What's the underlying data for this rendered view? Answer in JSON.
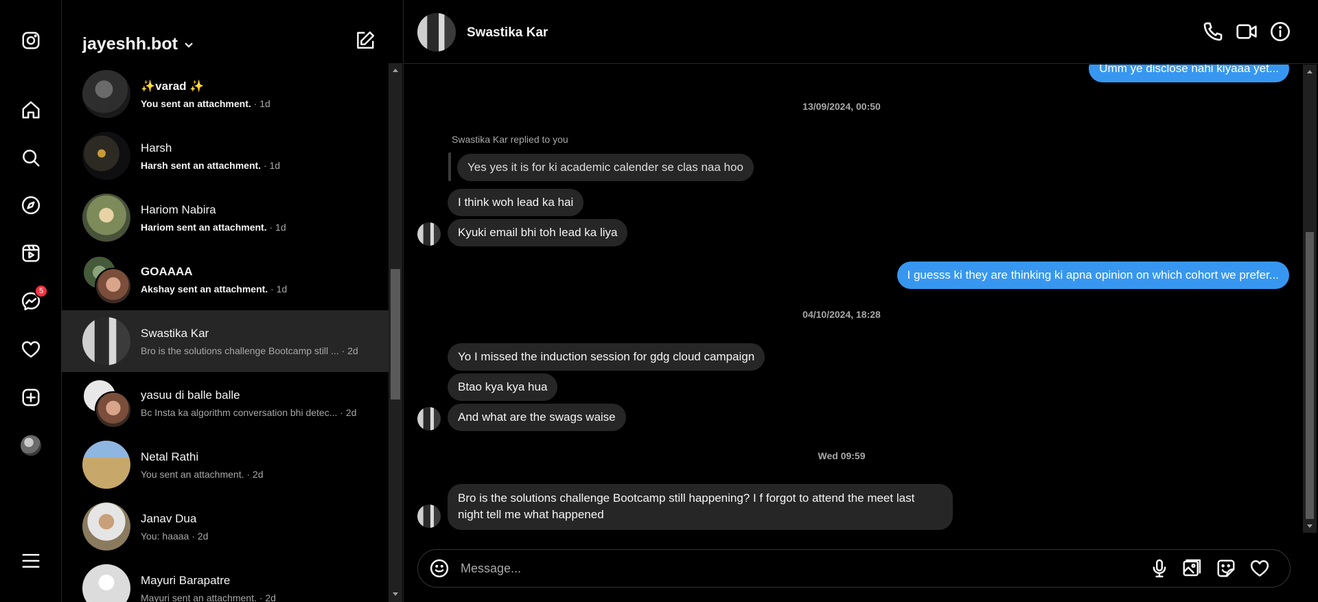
{
  "account": {
    "username": "jayeshh.bot"
  },
  "nav": {
    "messages_badge": "5"
  },
  "threads": [
    {
      "name": "✨varad ✨",
      "preview": "You sent an attachment.",
      "time": "· 1d",
      "unread": true
    },
    {
      "name": "Harsh",
      "preview": "Harsh sent an attachment.",
      "time": "· 1d",
      "unread": true
    },
    {
      "name": "Hariom Nabira",
      "preview": "Hariom sent an attachment.",
      "time": "· 1d",
      "unread": true
    },
    {
      "name": "GOAAAA",
      "preview": "Akshay sent an attachment.",
      "time": "· 1d",
      "unread": true
    },
    {
      "name": "Swastika Kar",
      "preview": "Bro is the solutions challenge Bootcamp still ...",
      "time": "· 2d",
      "unread": false
    },
    {
      "name": "yasuu di balle balle",
      "preview": "Bc Insta ka algorithm conversation bhi detec...",
      "time": "· 2d",
      "unread": false
    },
    {
      "name": "Netal Rathi",
      "preview": "You sent an attachment.",
      "time": "· 2d",
      "unread": false
    },
    {
      "name": "Janav Dua",
      "preview": "You: haaaa",
      "time": "· 2d",
      "unread": false
    },
    {
      "name": "Mayuri Barapatre",
      "preview": "Mayuri sent an attachment.",
      "time": "· 2d",
      "unread": false
    }
  ],
  "chat": {
    "title": "Swastika Kar",
    "messages": {
      "m0": "Umm ye disclose nahi kiyaaa yet...",
      "ts1": "13/09/2024, 00:50",
      "reply_label": "Swastika Kar replied to you",
      "reply_quote": "Yes yes it is for ki academic calender se clas naa hoo",
      "m1": "I think woh lead ka hai",
      "m2": "Kyuki email bhi toh lead ka liya",
      "m3": "I guesss ki they are thinking ki apna opinion on which cohort we prefer...",
      "ts2": "04/10/2024, 18:28",
      "m4": "Yo I missed  the induction session for gdg cloud campaign",
      "m5": "Btao kya kya hua",
      "m6": "And what are the swags waise",
      "ts3": "Wed 09:59",
      "m7": "Bro is the solutions challenge Bootcamp still happening? I f forgot to attend the meet last night tell me what happened"
    }
  },
  "composer": {
    "placeholder": "Message..."
  },
  "colors": {
    "accent": "#3797f0",
    "unread_dot": "#0095f6",
    "badge": "#ff3040"
  }
}
